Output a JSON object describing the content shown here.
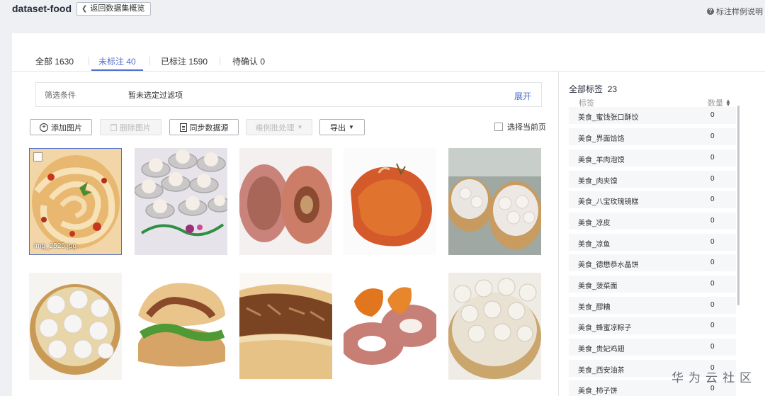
{
  "header": {
    "dataset_name": "dataset-food",
    "back_label": "返回数据集概览",
    "help_label": "标注样例说明"
  },
  "tabs": [
    {
      "label": "全部 1630"
    },
    {
      "label": "未标注 40"
    },
    {
      "label": "已标注 1590"
    },
    {
      "label": "待确认 0"
    }
  ],
  "filter": {
    "label": "筛选条件",
    "value": "暂未选定过滤项",
    "expand": "展开"
  },
  "toolbar": {
    "add_image": "添加图片",
    "delete_image": "删除图片",
    "sync_source": "同步数据源",
    "batch_process": "难例批处理",
    "export": "导出",
    "select_page": "选择当前页"
  },
  "images": [
    {
      "filename": "img_2525.jpg",
      "icon": "noodles-image"
    },
    {
      "icon": "dumplings-tray-image"
    },
    {
      "icon": "dried-persimmon-image"
    },
    {
      "icon": "persimmon-cake-image"
    },
    {
      "icon": "soup-dumplings-steamer-image"
    },
    {
      "icon": "xiaolongbao-image"
    },
    {
      "icon": "roujiamo-image"
    },
    {
      "icon": "meat-bun-image"
    },
    {
      "icon": "dried-persimmon-rings-image"
    },
    {
      "icon": "steamed-dumplings-image"
    }
  ],
  "labels_panel": {
    "title": "全部标签",
    "total": "23",
    "col_label": "标签",
    "col_count": "数量",
    "items": [
      {
        "name": "美食_蜜饯张口酥饺",
        "count": "0"
      },
      {
        "name": "美食_界面饸饹",
        "count": "0"
      },
      {
        "name": "美食_羊肉泡馍",
        "count": "0"
      },
      {
        "name": "美食_肉夹馍",
        "count": "0"
      },
      {
        "name": "美食_八宝玫瑰镜糕",
        "count": "0"
      },
      {
        "name": "美食_凉皮",
        "count": "0"
      },
      {
        "name": "美食_凉鱼",
        "count": "0"
      },
      {
        "name": "美食_德懋恭水晶饼",
        "count": "0"
      },
      {
        "name": "美食_菠菜面",
        "count": "0"
      },
      {
        "name": "美食_醪糟",
        "count": "0"
      },
      {
        "name": "美食_蜂蜜凉粽子",
        "count": "0"
      },
      {
        "name": "美食_贵妃鸡翅",
        "count": "0"
      },
      {
        "name": "美食_西安油茶",
        "count": "0"
      },
      {
        "name": "美食_柿子饼",
        "count": "0"
      }
    ]
  },
  "watermark": "华为云社区",
  "colors": {
    "accent": "#526ecc",
    "panel_bg": "#ffffff",
    "page_bg": "#eef0f3"
  }
}
